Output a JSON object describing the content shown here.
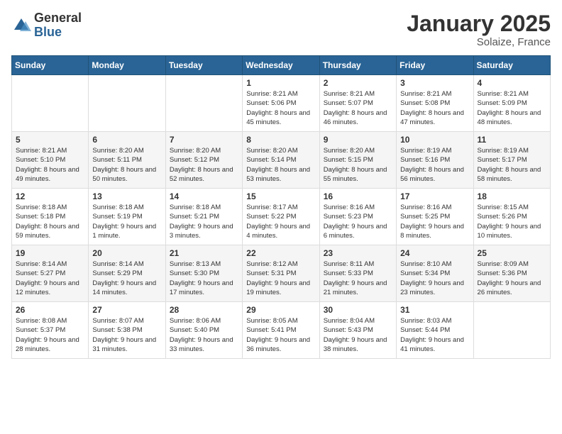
{
  "logo": {
    "general": "General",
    "blue": "Blue"
  },
  "title": "January 2025",
  "subtitle": "Solaize, France",
  "days_of_week": [
    "Sunday",
    "Monday",
    "Tuesday",
    "Wednesday",
    "Thursday",
    "Friday",
    "Saturday"
  ],
  "weeks": [
    [
      {
        "day": "",
        "info": ""
      },
      {
        "day": "",
        "info": ""
      },
      {
        "day": "",
        "info": ""
      },
      {
        "day": "1",
        "info": "Sunrise: 8:21 AM\nSunset: 5:06 PM\nDaylight: 8 hours and 45 minutes."
      },
      {
        "day": "2",
        "info": "Sunrise: 8:21 AM\nSunset: 5:07 PM\nDaylight: 8 hours and 46 minutes."
      },
      {
        "day": "3",
        "info": "Sunrise: 8:21 AM\nSunset: 5:08 PM\nDaylight: 8 hours and 47 minutes."
      },
      {
        "day": "4",
        "info": "Sunrise: 8:21 AM\nSunset: 5:09 PM\nDaylight: 8 hours and 48 minutes."
      }
    ],
    [
      {
        "day": "5",
        "info": "Sunrise: 8:21 AM\nSunset: 5:10 PM\nDaylight: 8 hours and 49 minutes."
      },
      {
        "day": "6",
        "info": "Sunrise: 8:20 AM\nSunset: 5:11 PM\nDaylight: 8 hours and 50 minutes."
      },
      {
        "day": "7",
        "info": "Sunrise: 8:20 AM\nSunset: 5:12 PM\nDaylight: 8 hours and 52 minutes."
      },
      {
        "day": "8",
        "info": "Sunrise: 8:20 AM\nSunset: 5:14 PM\nDaylight: 8 hours and 53 minutes."
      },
      {
        "day": "9",
        "info": "Sunrise: 8:20 AM\nSunset: 5:15 PM\nDaylight: 8 hours and 55 minutes."
      },
      {
        "day": "10",
        "info": "Sunrise: 8:19 AM\nSunset: 5:16 PM\nDaylight: 8 hours and 56 minutes."
      },
      {
        "day": "11",
        "info": "Sunrise: 8:19 AM\nSunset: 5:17 PM\nDaylight: 8 hours and 58 minutes."
      }
    ],
    [
      {
        "day": "12",
        "info": "Sunrise: 8:18 AM\nSunset: 5:18 PM\nDaylight: 8 hours and 59 minutes."
      },
      {
        "day": "13",
        "info": "Sunrise: 8:18 AM\nSunset: 5:19 PM\nDaylight: 9 hours and 1 minute."
      },
      {
        "day": "14",
        "info": "Sunrise: 8:18 AM\nSunset: 5:21 PM\nDaylight: 9 hours and 3 minutes."
      },
      {
        "day": "15",
        "info": "Sunrise: 8:17 AM\nSunset: 5:22 PM\nDaylight: 9 hours and 4 minutes."
      },
      {
        "day": "16",
        "info": "Sunrise: 8:16 AM\nSunset: 5:23 PM\nDaylight: 9 hours and 6 minutes."
      },
      {
        "day": "17",
        "info": "Sunrise: 8:16 AM\nSunset: 5:25 PM\nDaylight: 9 hours and 8 minutes."
      },
      {
        "day": "18",
        "info": "Sunrise: 8:15 AM\nSunset: 5:26 PM\nDaylight: 9 hours and 10 minutes."
      }
    ],
    [
      {
        "day": "19",
        "info": "Sunrise: 8:14 AM\nSunset: 5:27 PM\nDaylight: 9 hours and 12 minutes."
      },
      {
        "day": "20",
        "info": "Sunrise: 8:14 AM\nSunset: 5:29 PM\nDaylight: 9 hours and 14 minutes."
      },
      {
        "day": "21",
        "info": "Sunrise: 8:13 AM\nSunset: 5:30 PM\nDaylight: 9 hours and 17 minutes."
      },
      {
        "day": "22",
        "info": "Sunrise: 8:12 AM\nSunset: 5:31 PM\nDaylight: 9 hours and 19 minutes."
      },
      {
        "day": "23",
        "info": "Sunrise: 8:11 AM\nSunset: 5:33 PM\nDaylight: 9 hours and 21 minutes."
      },
      {
        "day": "24",
        "info": "Sunrise: 8:10 AM\nSunset: 5:34 PM\nDaylight: 9 hours and 23 minutes."
      },
      {
        "day": "25",
        "info": "Sunrise: 8:09 AM\nSunset: 5:36 PM\nDaylight: 9 hours and 26 minutes."
      }
    ],
    [
      {
        "day": "26",
        "info": "Sunrise: 8:08 AM\nSunset: 5:37 PM\nDaylight: 9 hours and 28 minutes."
      },
      {
        "day": "27",
        "info": "Sunrise: 8:07 AM\nSunset: 5:38 PM\nDaylight: 9 hours and 31 minutes."
      },
      {
        "day": "28",
        "info": "Sunrise: 8:06 AM\nSunset: 5:40 PM\nDaylight: 9 hours and 33 minutes."
      },
      {
        "day": "29",
        "info": "Sunrise: 8:05 AM\nSunset: 5:41 PM\nDaylight: 9 hours and 36 minutes."
      },
      {
        "day": "30",
        "info": "Sunrise: 8:04 AM\nSunset: 5:43 PM\nDaylight: 9 hours and 38 minutes."
      },
      {
        "day": "31",
        "info": "Sunrise: 8:03 AM\nSunset: 5:44 PM\nDaylight: 9 hours and 41 minutes."
      },
      {
        "day": "",
        "info": ""
      }
    ]
  ]
}
